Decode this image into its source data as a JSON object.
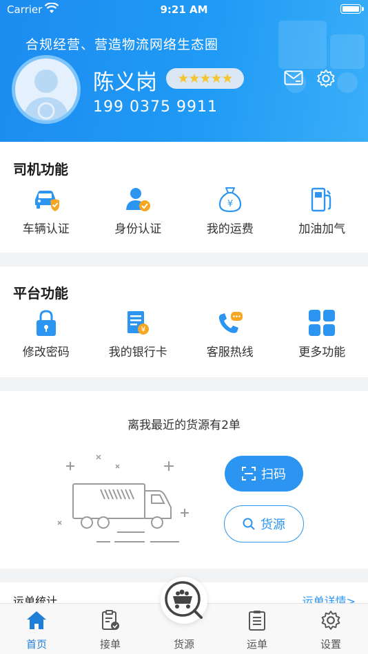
{
  "status_bar": {
    "carrier": "Carrier",
    "time": "9:21 AM"
  },
  "header": {
    "slogan": "合规经营、营造物流网络生态圈",
    "name": "陈义岗",
    "rating_stars": "★★★★★",
    "phone": "199 0375 9911"
  },
  "driver_section": {
    "title": "司机功能",
    "items": [
      {
        "label": "车辆认证",
        "icon": "car-verify-icon"
      },
      {
        "label": "身份认证",
        "icon": "identity-verify-icon"
      },
      {
        "label": "我的运费",
        "icon": "money-bag-icon"
      },
      {
        "label": "加油加气",
        "icon": "fuel-pump-icon"
      }
    ]
  },
  "platform_section": {
    "title": "平台功能",
    "items": [
      {
        "label": "修改密码",
        "icon": "lock-icon"
      },
      {
        "label": "我的银行卡",
        "icon": "bank-card-icon"
      },
      {
        "label": "客服热线",
        "icon": "phone-chat-icon"
      },
      {
        "label": "更多功能",
        "icon": "grid-icon"
      }
    ]
  },
  "nearby": {
    "text": "离我最近的货源有2单",
    "scan_label": "扫码",
    "source_label": "货源"
  },
  "stats": {
    "title": "运单统计",
    "link": "运单详情>"
  },
  "tabbar": {
    "tabs": [
      {
        "label": "首页"
      },
      {
        "label": "接单"
      },
      {
        "label": "货源"
      },
      {
        "label": "运单"
      },
      {
        "label": "设置"
      }
    ]
  },
  "colors": {
    "primary": "#1d8cf0",
    "accent_orange": "#f5a623",
    "star": "#f6c430"
  }
}
